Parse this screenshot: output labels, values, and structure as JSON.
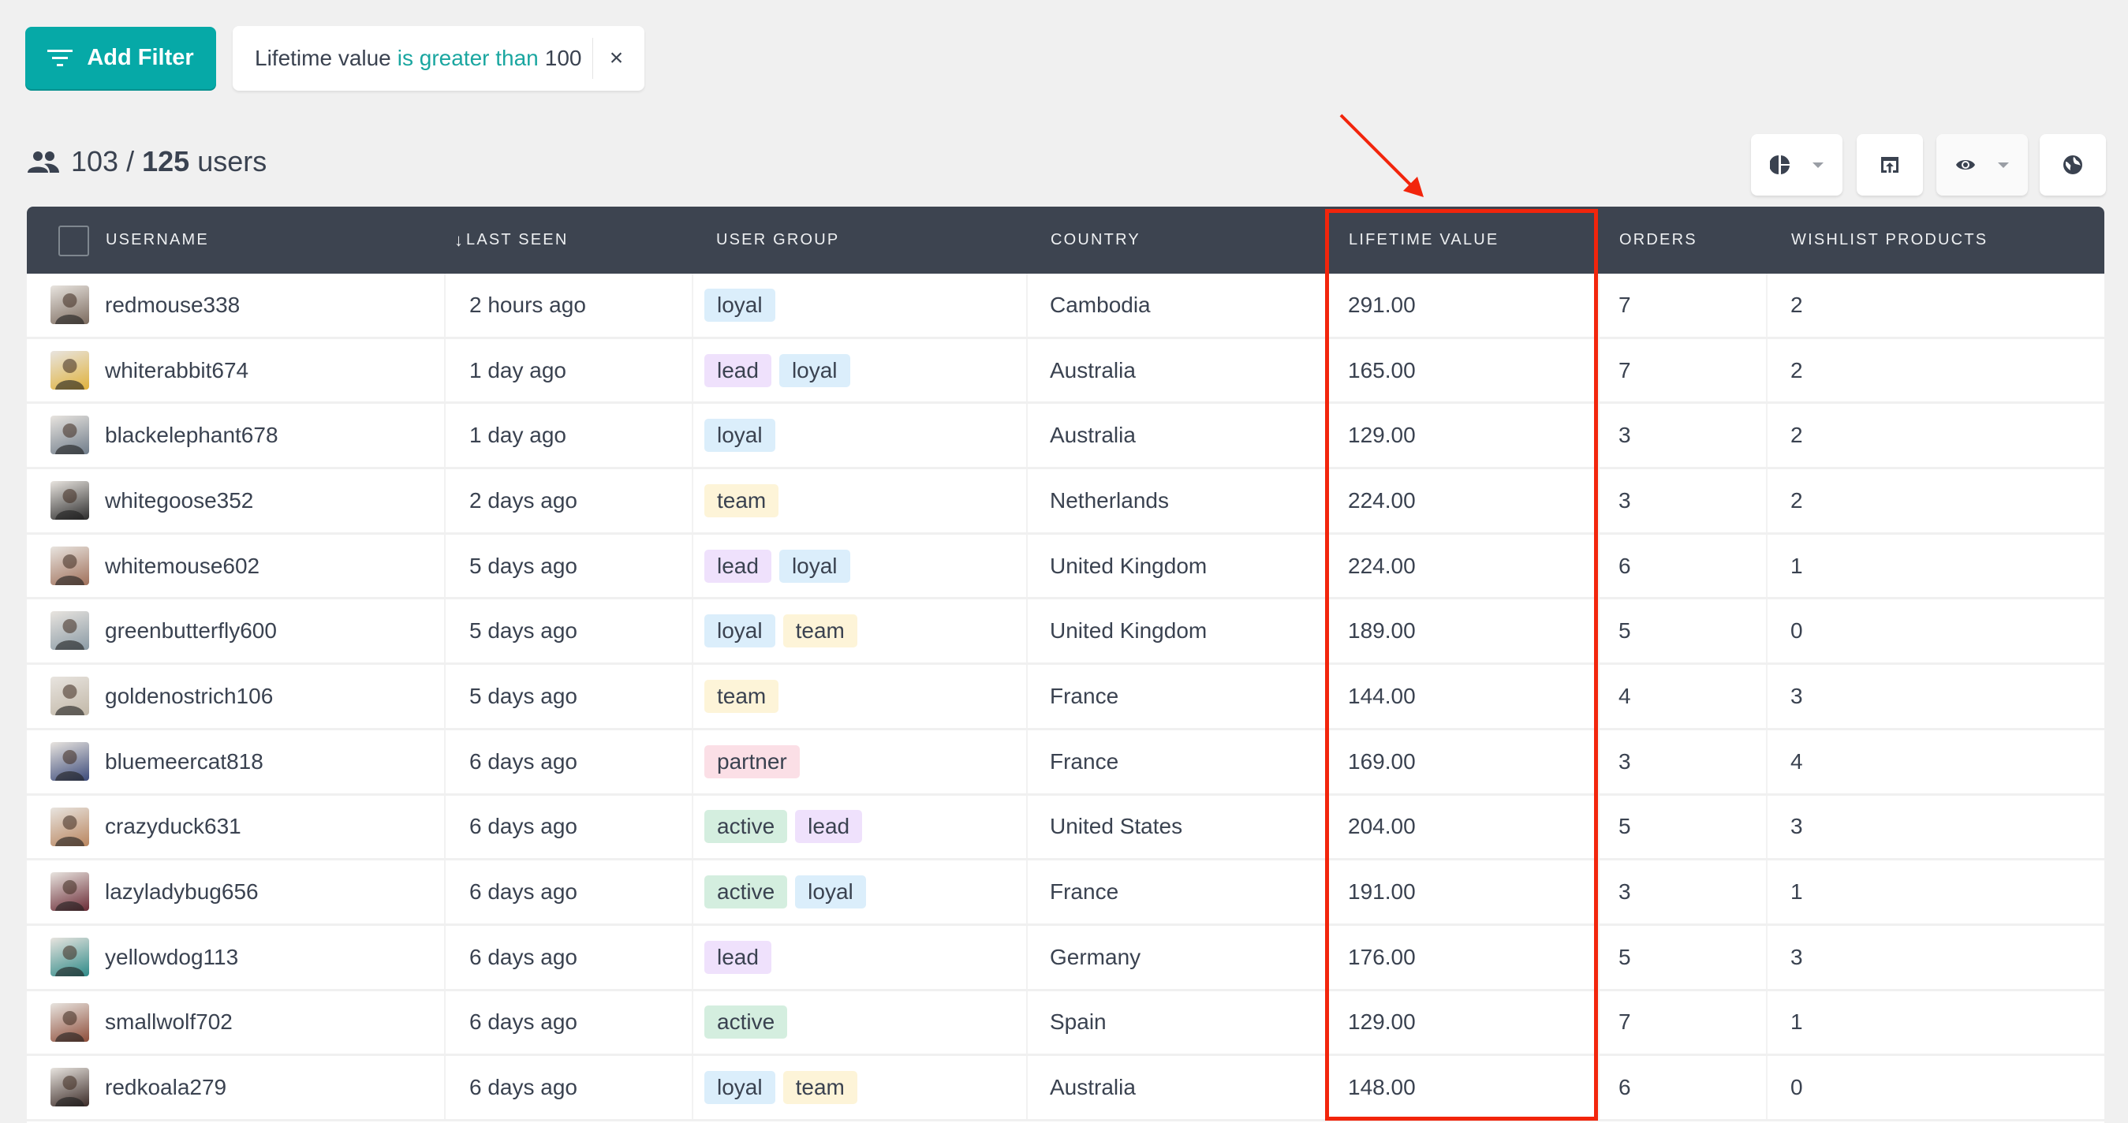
{
  "toolbar": {
    "add_filter_label": "Add Filter",
    "add_filter_icon": "filter-icon",
    "filter_chip": {
      "field": "Lifetime value",
      "operator": "is greater than",
      "value": "100",
      "close_symbol": "×"
    }
  },
  "summary": {
    "icon": "users-icon",
    "shown": "103",
    "separator": "/",
    "total": "125",
    "unit": "users"
  },
  "tools": [
    {
      "name": "pie-chart-icon",
      "has_dropdown": true
    },
    {
      "name": "export-icon",
      "has_dropdown": false
    },
    {
      "name": "eye-icon",
      "has_dropdown": true
    },
    {
      "name": "globe-icon",
      "has_dropdown": false
    }
  ],
  "table": {
    "columns": [
      {
        "label": "USERNAME",
        "sort": ""
      },
      {
        "label": "LAST SEEN",
        "sort": "↓"
      },
      {
        "label": "USER GROUP",
        "sort": ""
      },
      {
        "label": "COUNTRY",
        "sort": ""
      },
      {
        "label": "LIFETIME VALUE",
        "sort": ""
      },
      {
        "label": "ORDERS",
        "sort": ""
      },
      {
        "label": "WISHLIST PRODUCTS",
        "sort": ""
      }
    ],
    "group_colors": {
      "loyal": "#dbeefb",
      "lead": "#efe1fc",
      "team": "#fdf4d8",
      "partner": "#fbdfe6",
      "active": "#d4eedf"
    },
    "rows": [
      {
        "username": "redmouse338",
        "last_seen": "2 hours ago",
        "groups": [
          "loyal"
        ],
        "country": "Cambodia",
        "lifetime_value": "291.00",
        "orders": "7",
        "wishlist": "2"
      },
      {
        "username": "whiterabbit674",
        "last_seen": "1 day ago",
        "groups": [
          "lead",
          "loyal"
        ],
        "country": "Australia",
        "lifetime_value": "165.00",
        "orders": "7",
        "wishlist": "2"
      },
      {
        "username": "blackelephant678",
        "last_seen": "1 day ago",
        "groups": [
          "loyal"
        ],
        "country": "Australia",
        "lifetime_value": "129.00",
        "orders": "3",
        "wishlist": "2"
      },
      {
        "username": "whitegoose352",
        "last_seen": "2 days ago",
        "groups": [
          "team"
        ],
        "country": "Netherlands",
        "lifetime_value": "224.00",
        "orders": "3",
        "wishlist": "2"
      },
      {
        "username": "whitemouse602",
        "last_seen": "5 days ago",
        "groups": [
          "lead",
          "loyal"
        ],
        "country": "United Kingdom",
        "lifetime_value": "224.00",
        "orders": "6",
        "wishlist": "1"
      },
      {
        "username": "greenbutterfly600",
        "last_seen": "5 days ago",
        "groups": [
          "loyal",
          "team"
        ],
        "country": "United Kingdom",
        "lifetime_value": "189.00",
        "orders": "5",
        "wishlist": "0"
      },
      {
        "username": "goldenostrich106",
        "last_seen": "5 days ago",
        "groups": [
          "team"
        ],
        "country": "France",
        "lifetime_value": "144.00",
        "orders": "4",
        "wishlist": "3"
      },
      {
        "username": "bluemeercat818",
        "last_seen": "6 days ago",
        "groups": [
          "partner"
        ],
        "country": "France",
        "lifetime_value": "169.00",
        "orders": "3",
        "wishlist": "4"
      },
      {
        "username": "crazyduck631",
        "last_seen": "6 days ago",
        "groups": [
          "active",
          "lead"
        ],
        "country": "United States",
        "lifetime_value": "204.00",
        "orders": "5",
        "wishlist": "3"
      },
      {
        "username": "lazyladybug656",
        "last_seen": "6 days ago",
        "groups": [
          "active",
          "loyal"
        ],
        "country": "France",
        "lifetime_value": "191.00",
        "orders": "3",
        "wishlist": "1"
      },
      {
        "username": "yellowdog113",
        "last_seen": "6 days ago",
        "groups": [
          "lead"
        ],
        "country": "Germany",
        "lifetime_value": "176.00",
        "orders": "5",
        "wishlist": "3"
      },
      {
        "username": "smallwolf702",
        "last_seen": "6 days ago",
        "groups": [
          "active"
        ],
        "country": "Spain",
        "lifetime_value": "129.00",
        "orders": "7",
        "wishlist": "1"
      },
      {
        "username": "redkoala279",
        "last_seen": "6 days ago",
        "groups": [
          "loyal",
          "team"
        ],
        "country": "Australia",
        "lifetime_value": "148.00",
        "orders": "6",
        "wishlist": "0"
      }
    ]
  },
  "annotation": {
    "highlight_color": "#f2250c",
    "highlighted_column": "LIFETIME VALUE"
  },
  "colors": {
    "accent": "#06a9a7",
    "header_bg": "#3d4450",
    "text": "#3a4250",
    "operator_text": "#1aa6a0"
  }
}
